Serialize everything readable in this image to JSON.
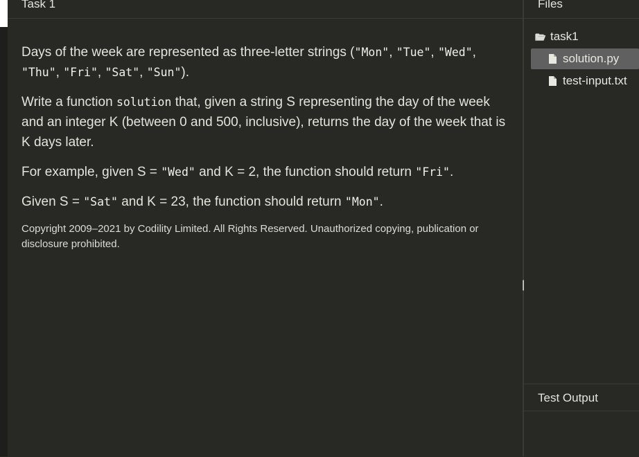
{
  "task_panel": {
    "title": "Task 1",
    "para1": [
      {
        "t": "Days of the week are represented as three-letter strings (",
        "code": false
      },
      {
        "t": "\"Mon\"",
        "code": true
      },
      {
        "t": ", ",
        "code": false
      },
      {
        "t": "\"Tue\"",
        "code": true
      },
      {
        "t": ", ",
        "code": false
      },
      {
        "t": "\"Wed\"",
        "code": true
      },
      {
        "t": ", ",
        "code": false
      },
      {
        "t": "\"Thu\"",
        "code": true
      },
      {
        "t": ", ",
        "code": false
      },
      {
        "t": "\"Fri\"",
        "code": true
      },
      {
        "t": ", ",
        "code": false
      },
      {
        "t": "\"Sat\"",
        "code": true
      },
      {
        "t": ", ",
        "code": false
      },
      {
        "t": "\"Sun\"",
        "code": true
      },
      {
        "t": ").",
        "code": false
      }
    ],
    "para2": [
      {
        "t": "Write a function ",
        "code": false
      },
      {
        "t": "solution",
        "code": true
      },
      {
        "t": " that, given a string S representing the day of the week and an integer K (between 0 and 500, inclusive), returns the day of the week that is K days later.",
        "code": false
      }
    ],
    "para3": [
      {
        "t": "For example, given S = ",
        "code": false
      },
      {
        "t": "\"Wed\"",
        "code": true
      },
      {
        "t": " and K = 2, the function should return ",
        "code": false
      },
      {
        "t": "\"Fri\"",
        "code": true
      },
      {
        "t": ".",
        "code": false
      }
    ],
    "para4": [
      {
        "t": "Given S = ",
        "code": false
      },
      {
        "t": "\"Sat\"",
        "code": true
      },
      {
        "t": " and K = 23, the function should return ",
        "code": false
      },
      {
        "t": "\"Mon\"",
        "code": true
      },
      {
        "t": ".",
        "code": false
      }
    ],
    "copyright": "Copyright 2009–2021 by Codility Limited. All Rights Reserved. Unauthorized copying, publication or disclosure prohibited."
  },
  "splitter": {
    "handle": "||"
  },
  "files_panel": {
    "title": "Files",
    "folder": {
      "name": "task1",
      "icon": "folder-open-icon"
    },
    "files": [
      {
        "name": "solution.py",
        "icon": "file-icon",
        "selected": true
      },
      {
        "name": "test-input.txt",
        "icon": "file-icon",
        "selected": false
      }
    ]
  },
  "test_output": {
    "title": "Test Output"
  },
  "colors": {
    "background": "#282825",
    "selected_file": "#606060",
    "text": "#e4e4dc"
  }
}
